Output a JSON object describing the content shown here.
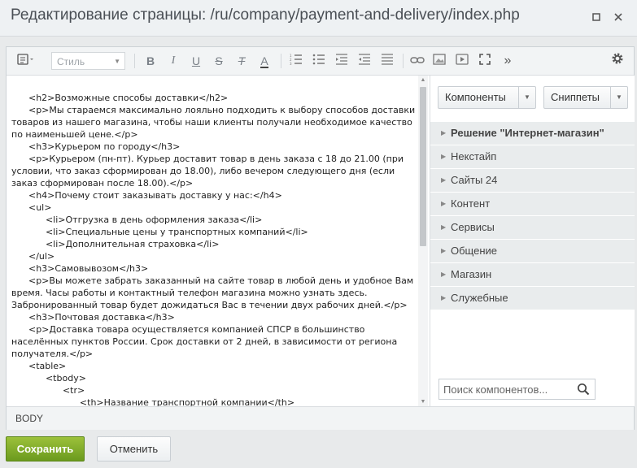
{
  "window": {
    "title": "Редактирование страницы: /ru/company/payment-and-delivery/index.php",
    "minimize_icon": "square-icon",
    "close_icon": "close-icon"
  },
  "toolbar": {
    "style_select_value": "Стиль",
    "buttons": [
      "source-code",
      "bold",
      "italic",
      "underline",
      "strikethrough",
      "remove-format",
      "text-color",
      "ordered-list",
      "unordered-list",
      "outdent",
      "indent",
      "justify",
      "link",
      "image",
      "video",
      "fullscreen",
      "more",
      "settings"
    ],
    "bold_label": "B",
    "italic_label": "I",
    "underline_label": "U",
    "strike_label": "S",
    "clear_label": "T",
    "color_label": "A",
    "more_label": "»"
  },
  "editor": {
    "lines": [
      "      <h2>Возможные способы доставки</h2>",
      "      <p>Мы стараемся максимально лояльно подходить к выбору способов доставки товаров из нашего магазина, чтобы наши клиенты получали необходимое качество по наименьшей цене.</p>",
      "      <h3>Курьером по городу</h3>",
      "      <p>Курьером (пн-пт). Курьер доставит товар в день заказа с 18 до 21.00 (при условии, что заказ сформирован до 18.00), либо вечером следующего дня (если заказ сформирован после 18.00).</p>",
      "      <h4>Почему стоит заказывать доставку у нас:</h4>",
      "      <ul>",
      "            <li>Отгрузка в день оформления заказа</li>",
      "            <li>Специальные цены у транспортных компаний</li>",
      "            <li>Дополнительная страховка</li>",
      "      </ul>",
      "      <h3>Самовывозом</h3>",
      "      <p>Вы можете забрать заказанный на сайте товар в любой день и удобное Вам время. Часы работы и контактный телефон магазина можно узнать здесь. Забронированный товар будет дожидаться Вас в течении двух рабочих дней.</p>",
      "      <h3>Почтовая доставка</h3>",
      "      <p>Доставка товара осуществляется компанией СПСР в большинство населённых пунктов России. Срок доставки от 2 дней, в зависимости от региона получателя.</p>",
      "      <table>",
      "            <tbody>",
      "                  <tr>",
      "                        <th>Название транспортной компании</th>"
    ]
  },
  "sidebar": {
    "components_button": "Компоненты",
    "snippets_button": "Сниппеты",
    "items": [
      {
        "label": "Решение \"Интернет-магазин\""
      },
      {
        "label": "Некстайп"
      },
      {
        "label": "Сайты 24"
      },
      {
        "label": "Контент"
      },
      {
        "label": "Сервисы"
      },
      {
        "label": "Общение"
      },
      {
        "label": "Магазин"
      },
      {
        "label": "Служебные"
      }
    ],
    "search_placeholder": "Поиск компонентов...",
    "search_value": ""
  },
  "statusbar": {
    "path": "BODY"
  },
  "footer": {
    "save_label": "Сохранить",
    "cancel_label": "Отменить"
  },
  "colors": {
    "save_button": "#7aa826",
    "title_text": "#4a4f55",
    "component_item_bg": "#e9eced"
  }
}
